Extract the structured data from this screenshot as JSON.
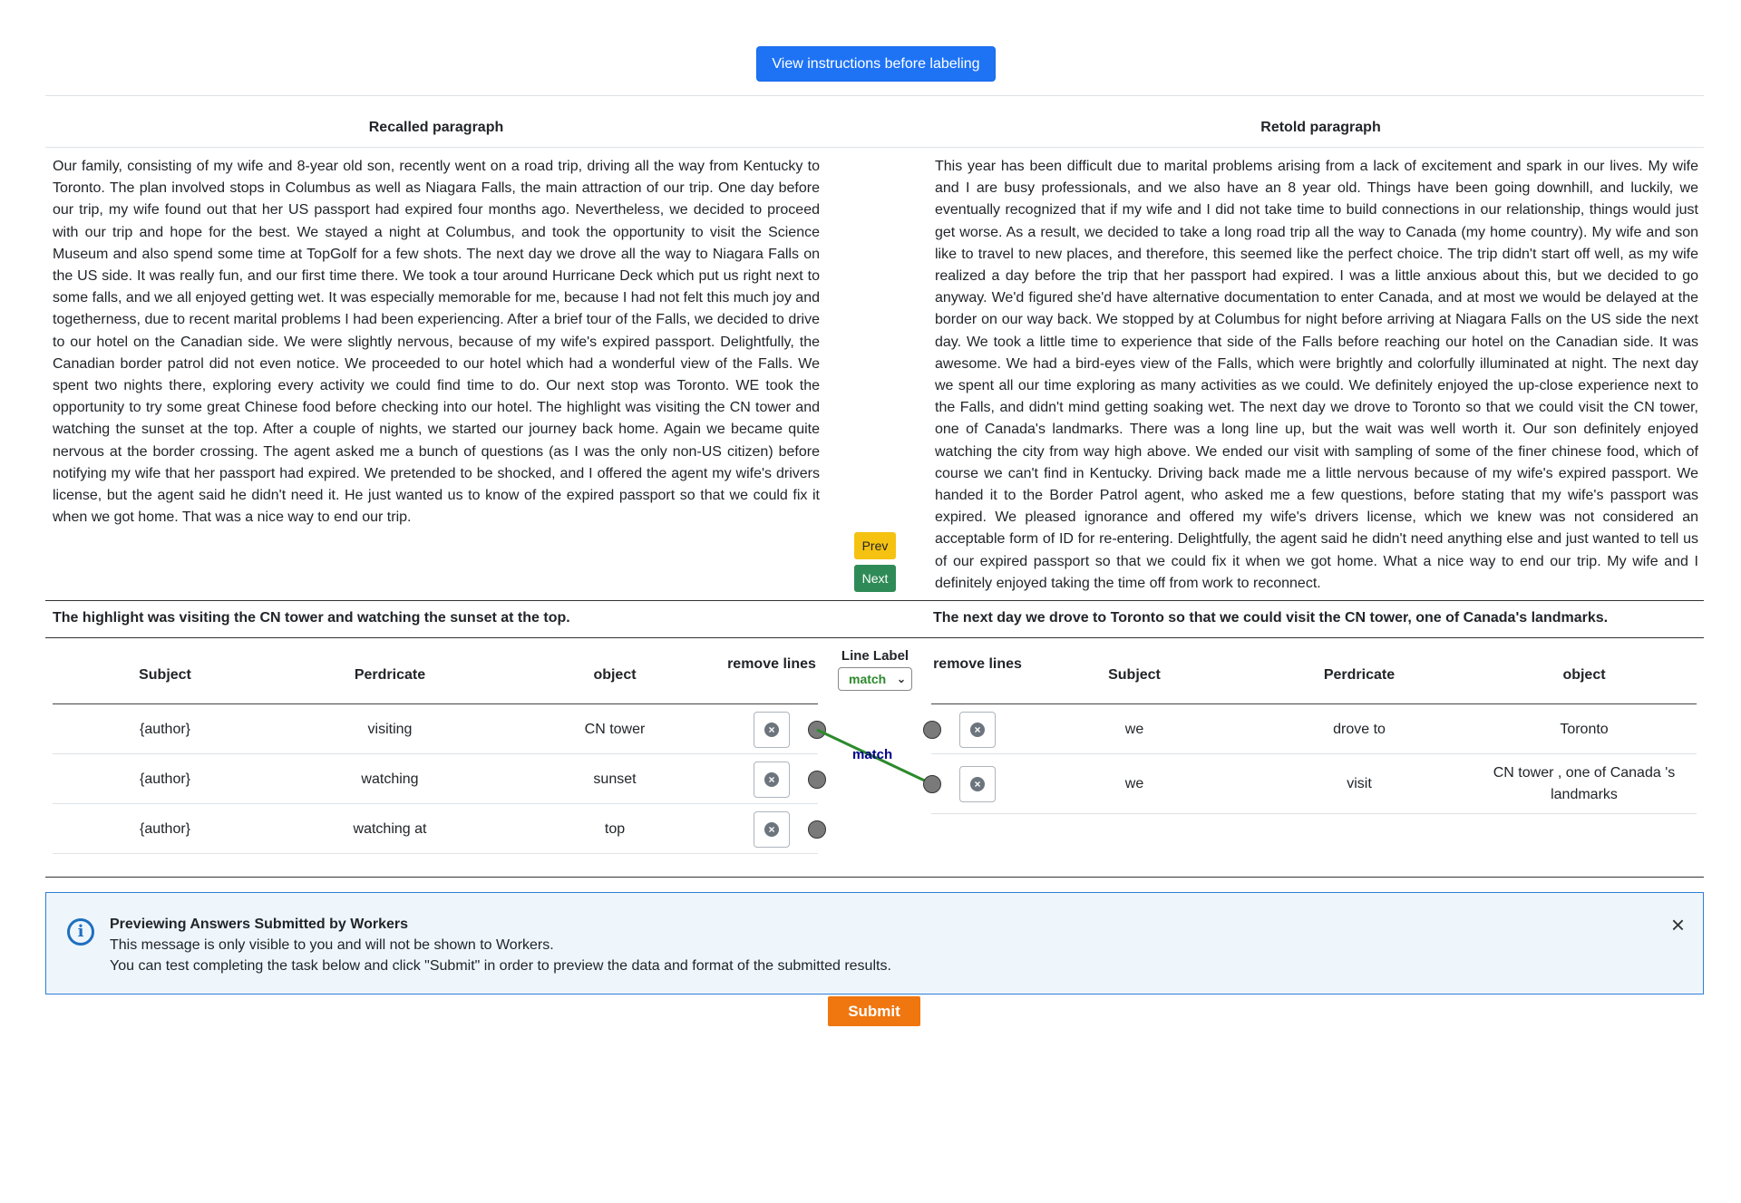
{
  "top": {
    "instructions_button": "View instructions before labeling"
  },
  "left_panel": {
    "heading": "Recalled paragraph",
    "paragraph": "Our family, consisting of my wife and 8-year old son, recently went on a road trip, driving all the way from Kentucky to Toronto. The plan involved stops in Columbus as well as Niagara Falls, the main attraction of our trip. One day before our trip, my wife found out that her US passport had expired four months ago. Nevertheless, we decided to proceed with our trip and hope for the best. We stayed a night at Columbus, and took the opportunity to visit the Science Museum and also spend some time at TopGolf for a few shots. The next day we drove all the way to Niagara Falls on the US side. It was really fun, and our first time there. We took a tour around Hurricane Deck which put us right next to some falls, and we all enjoyed getting wet. It was especially memorable for me, because I had not felt this much joy and togetherness, due to recent marital problems I had been experiencing. After a brief tour of the Falls, we decided to drive to our hotel on the Canadian side. We were slightly nervous, because of my wife's expired passport. Delightfully, the Canadian border patrol did not even notice. We proceeded to our hotel which had a wonderful view of the Falls. We spent two nights there, exploring every activity we could find time to do. Our next stop was Toronto. WE took the opportunity to try some great Chinese food before checking into our hotel. The highlight was visiting the CN tower and watching the sunset at the top. After a couple of nights, we started our journey back home. Again we became quite nervous at the border crossing. The agent asked me a bunch of questions (as I was the only non-US citizen) before notifying my wife that her passport had expired. We pretended to be shocked, and I offered the agent my wife's drivers license, but the agent said he didn't need it. He just wanted us to know of the expired passport so that we could fix it when we got home. That was a nice way to end our trip.",
    "sentence": "The highlight was visiting the CN tower and watching the sunset at the top."
  },
  "right_panel": {
    "heading": "Retold paragraph",
    "paragraph": "This year has been difficult due to marital problems arising from a lack of excitement and spark in our lives. My wife and I are busy professionals, and we also have an 8 year old. Things have been going downhill, and luckily, we eventually recognized that if my wife and I did not take time to build connections in our relationship, things would just get worse. As a result, we decided to take a long road trip all the way to Canada (my home country). My wife and son like to travel to new places, and therefore, this seemed like the perfect choice. The trip didn't start off well, as my wife realized a day before the trip that her passport had expired. I was a little anxious about this, but we decided to go anyway. We'd figured she'd have alternative documentation to enter Canada, and at most we would be delayed at the border on our way back. We stopped by at Columbus for night before arriving at Niagara Falls on the US side the next day. We took a little time to experience that side of the Falls before reaching our hotel on the Canadian side. It was awesome. We had a bird-eyes view of the Falls, which were brightly and colorfully illuminated at night. The next day we spent all our time exploring as many activities as we could. We definitely enjoyed the up-close experience next to the Falls, and didn't mind getting soaking wet. The next day we drove to Toronto so that we could visit the CN tower, one of Canada's landmarks. There was a long line up, but the wait was well worth it. Our son definitely enjoyed watching the city from way high above. We ended our visit with sampling of some of the finer chinese food, which of course we can't find in Kentucky. Driving back made me a little nervous because of my wife's expired passport. We handed it to the Border Patrol agent, who asked me a few questions, before stating that my wife's passport was expired. We pleased ignorance and offered my wife's drivers license, which we knew was not considered an acceptable form of ID for re-entering. Delightfully, the agent said he didn't need anything else and just wanted to tell us of our expired passport so that we could fix it when we got home. What a nice way to end our trip. My wife and I definitely enjoyed taking the time off from work to reconnect.",
    "sentence": "The next day we drove to Toronto so that we could visit the CN tower, one of Canada's landmarks."
  },
  "nav": {
    "prev": "Prev",
    "next": "Next"
  },
  "left_table": {
    "headers": {
      "subject": "Subject",
      "predicate": "Perdricate",
      "object": "object",
      "remove": "remove lines"
    },
    "rows": [
      {
        "subject": "{author}",
        "predicate": "visiting",
        "object": "CN tower"
      },
      {
        "subject": "{author}",
        "predicate": "watching",
        "object": "sunset"
      },
      {
        "subject": "{author}",
        "predicate": "watching at",
        "object": "top"
      }
    ]
  },
  "right_table": {
    "headers": {
      "remove": "remove lines",
      "subject": "Subject",
      "predicate": "Perdricate",
      "object": "object"
    },
    "rows": [
      {
        "subject": "we",
        "predicate": "drove to",
        "object": "Toronto"
      },
      {
        "subject": "we",
        "predicate": "visit",
        "object": "CN tower , one of Canada 's landmarks"
      }
    ]
  },
  "line_label": {
    "title": "Line Label",
    "selected": "match",
    "link_label": "match",
    "link_color": "#2c8a2c",
    "label_color": "#00008b"
  },
  "remove_icon": "x-circle-icon",
  "alert": {
    "icon": "info-icon",
    "title": "Previewing Answers Submitted by Workers",
    "line1": "This message is only visible to you and will not be shown to Workers.",
    "line2": "You can test completing the task below and click \"Submit\" in order to preview the data and format of the submitted results.",
    "close": "×"
  },
  "submit": "Submit",
  "colors": {
    "primary": "#1e73f5",
    "prev": "#f5c211",
    "next": "#2e8b57",
    "submit": "#f0760f"
  }
}
